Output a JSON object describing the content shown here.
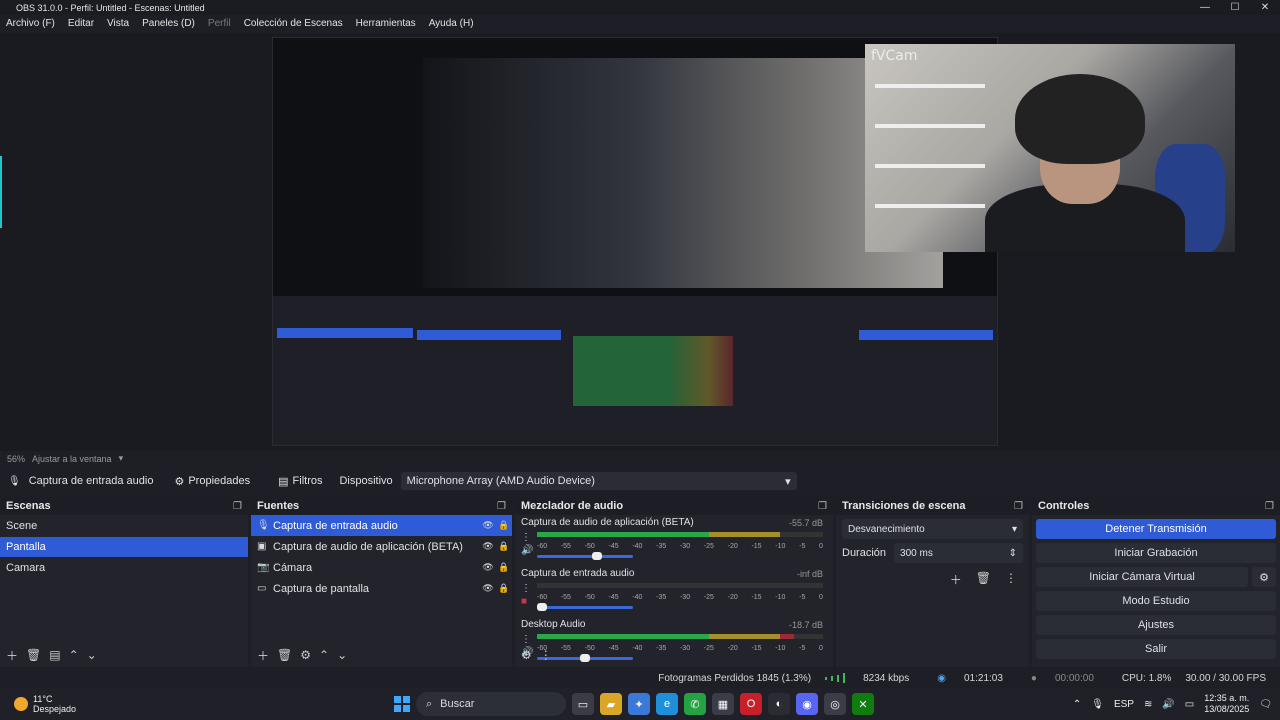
{
  "window": {
    "title": "OBS 31.0.0 - Perfil: Untitled - Escenas: Untitled",
    "min": "—",
    "max": "☐",
    "close": "✕"
  },
  "menu": [
    "Archivo (F)",
    "Editar",
    "Vista",
    "Paneles (D)",
    "Perfil",
    "Colección de Escenas",
    "Herramientas",
    "Ayuda (H)"
  ],
  "preview": {
    "webcam_label": "fVCam"
  },
  "zoom": {
    "percent": "56%",
    "fit_label": "Ajustar a la ventana"
  },
  "context": {
    "source": "Captura de entrada audio",
    "properties": "Propiedades",
    "filters": "Filtros",
    "device_label": "Dispositivo",
    "device_value": "Microphone Array (AMD Audio Device)"
  },
  "scenes": {
    "title": "Escenas",
    "items": [
      "Scene",
      "Pantalla",
      "Camara"
    ],
    "selected_index": 1
  },
  "sources": {
    "title": "Fuentes",
    "items": [
      {
        "name": "Captura de entrada audio",
        "icon": "mic-icon"
      },
      {
        "name": "Captura de audio de aplicación (BETA)",
        "icon": "app-audio-icon"
      },
      {
        "name": "Cámara",
        "icon": "camera-icon"
      },
      {
        "name": "Captura de pantalla",
        "icon": "monitor-icon"
      }
    ],
    "selected_index": 0
  },
  "mixer": {
    "title": "Mezclador de audio",
    "ticks": [
      "-60",
      "-55",
      "-50",
      "-45",
      "-40",
      "-35",
      "-30",
      "-25",
      "-20",
      "-15",
      "-10",
      "-5",
      "0"
    ],
    "tracks": [
      {
        "name": "Captura de audio de aplicación (BETA)",
        "db": "-55.7 dB",
        "level": 0.85,
        "volume": 0.62
      },
      {
        "name": "Captura de entrada audio",
        "db": "-inf dB",
        "level": 0.0,
        "volume": 0.05
      },
      {
        "name": "Desktop Audio",
        "db": "-18.7 dB",
        "level": 0.9,
        "volume": 0.5
      }
    ]
  },
  "transitions": {
    "title": "Transiciones de escena",
    "selected": "Desvanecimiento",
    "duration_label": "Duración",
    "duration_value": "300 ms"
  },
  "controls": {
    "title": "Controles",
    "buttons": [
      "Detener Transmisión",
      "Iniciar Grabación",
      "Iniciar Cámara Virtual",
      "Modo Estudio",
      "Ajustes",
      "Salir"
    ]
  },
  "status": {
    "dropped": "Fotogramas Perdidos 1845 (1.3%)",
    "bitrate": "8234 kbps",
    "stream_time": "01:21:03",
    "rec_time": "00:00:00",
    "cpu": "CPU: 1.8%",
    "fps": "30.00 / 30.00 FPS"
  },
  "taskbar": {
    "temp": "11°C",
    "weather": "Despejado",
    "search": "Buscar",
    "lang": "ESP",
    "time": "12:35 a. m.",
    "date": "13/08/2025"
  },
  "colors": {
    "accent": "#2f5bd6",
    "meter_green": "#2aa74b",
    "meter_yellow": "#a48f2a",
    "meter_red": "#9a2a35"
  }
}
